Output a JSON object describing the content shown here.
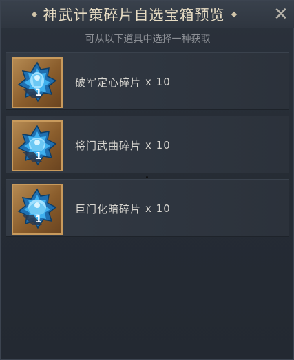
{
  "dialog": {
    "title": "神武计策碎片自选宝箱预览",
    "close_label": "✕",
    "subtitle": "可从以下道具中选择一种获取"
  },
  "items": [
    {
      "name": "破军定心碎片",
      "quantity": "x 10",
      "count": "1",
      "icon": "blue-fragment-icon"
    },
    {
      "name": "将门武曲碎片",
      "quantity": "x 10",
      "count": "1",
      "icon": "blue-fragment-icon"
    },
    {
      "name": "巨门化暗碎片",
      "quantity": "x 10",
      "count": "1",
      "icon": "blue-fragment-icon"
    }
  ],
  "colors": {
    "background": "#20262f",
    "title_text": "#e7dcc3",
    "icon_frame": "#c89a5c",
    "fragment_blue": "#38a8e8"
  }
}
